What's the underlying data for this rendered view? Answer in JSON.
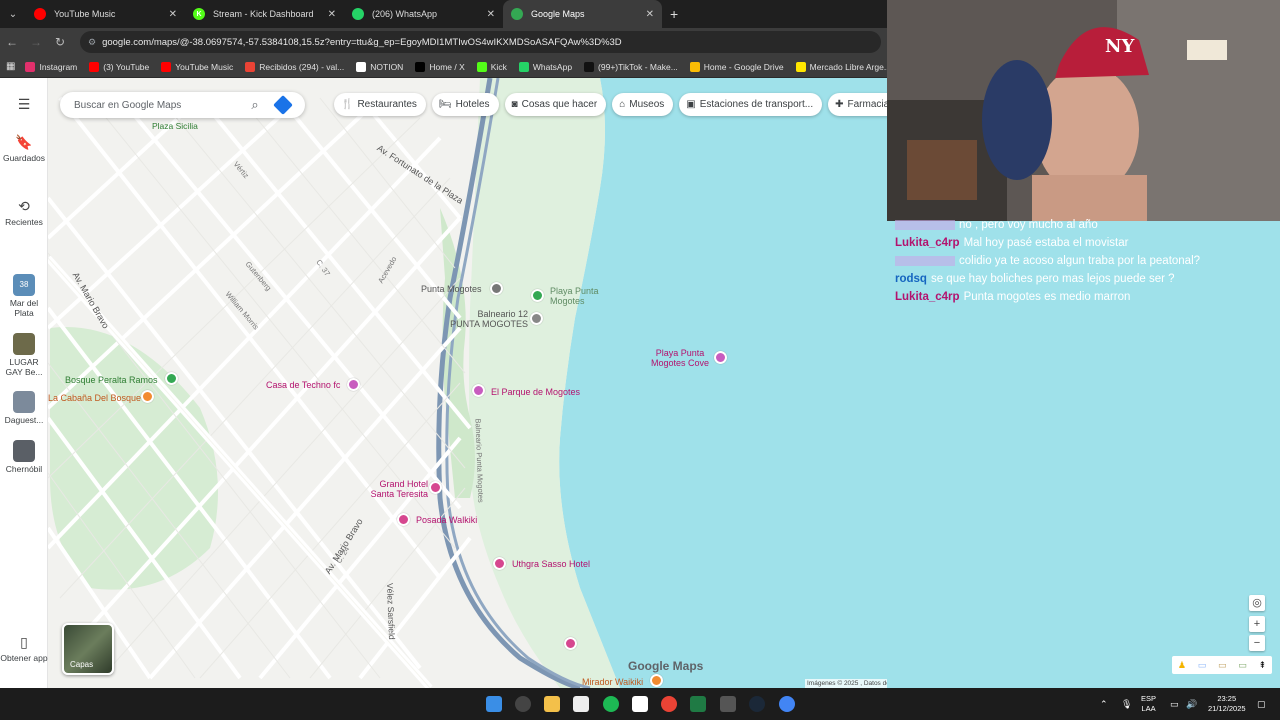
{
  "browser": {
    "tabs": [
      {
        "label": "YouTube Music",
        "color": "#ff0000",
        "glyph": ""
      },
      {
        "label": "Stream - Kick Dashboard",
        "color": "#53fc18",
        "glyph": "K"
      },
      {
        "label": "(206) WhatsApp",
        "color": "#25d366",
        "glyph": ""
      },
      {
        "label": "Google Maps",
        "color": "#34a853",
        "glyph": ""
      }
    ],
    "active_tab": 3,
    "url": "google.com/maps/@-38.0697574,-57.5384108,15.5z?entry=ttu&g_ep=EgoyMDI1MTIwOS4wIKXMDSoASAFQAw%3D%3D",
    "bookmarks": [
      {
        "label": "Instagram",
        "color": "#e1306c"
      },
      {
        "label": "(3) YouTube",
        "color": "#ff0000"
      },
      {
        "label": "YouTube Music",
        "color": "#ff0000"
      },
      {
        "label": "Recibidos (294) - val...",
        "color": "#ea4335"
      },
      {
        "label": "NOTION",
        "color": "#ffffff"
      },
      {
        "label": "Home / X",
        "color": "#000000"
      },
      {
        "label": "Kick",
        "color": "#53fc18"
      },
      {
        "label": "WhatsApp",
        "color": "#25d366"
      },
      {
        "label": "(99+)TikTok - Make...",
        "color": "#111111"
      },
      {
        "label": "Home - Google Drive",
        "color": "#fbbc04"
      },
      {
        "label": "Mercado Libre Arge...",
        "color": "#ffe600"
      }
    ]
  },
  "maps": {
    "search_placeholder": "Buscar en Google Maps",
    "rail": {
      "saved": "Guardados",
      "recent": "Recientes",
      "places": [
        {
          "label": "Mar del Plata",
          "badge": "38",
          "color": "#5b8db8"
        },
        {
          "label": "LUGAR GAY Be...",
          "color": "#6d6a4a"
        },
        {
          "label": "Daguest...",
          "color": "#7c8a9b"
        },
        {
          "label": "Chernóbil",
          "color": "#5a5f66"
        }
      ],
      "get_app": "Obtener app"
    },
    "chips": [
      {
        "label": "Restaurantes",
        "icon": "fork-knife-icon"
      },
      {
        "label": "Hoteles",
        "icon": "bed-icon"
      },
      {
        "label": "Cosas que hacer",
        "icon": "camera-icon"
      },
      {
        "label": "Museos",
        "icon": "museum-icon"
      },
      {
        "label": "Estaciones de transport...",
        "icon": "transit-icon"
      },
      {
        "label": "Farmacias",
        "icon": "pharmacy-icon"
      }
    ],
    "places": {
      "plaza_sicilia": "Plaza Sicilia",
      "punta_mogotes": "Punta Mogotes",
      "playa_punta_mogotes": "Playa Punta Mogotes",
      "balneario_12": "Balneario 12 PUNTA MOGOTES",
      "playa_cove": "Playa Punta Mogotes Cove",
      "parque": "El Parque de Mogotes",
      "bosque": "Bosque Peralta Ramos",
      "cabana": "La Cabaña Del Bosque",
      "techno": "Casa de Techno fc",
      "grand_hotel": "Grand Hotel Santa Teresita",
      "posada": "Posada Walkiki",
      "uthgra": "Uthgra Sasso Hotel",
      "mirador": "Mirador Waikiki"
    },
    "streets": {
      "fortunato": "Av. Fortunato de la Plaza",
      "mario_bravo": "Av. Mario Bravo",
      "mario_bravo2": "Av. Mario Bravo",
      "balneario": "Balneario Punta Mogotes",
      "velez": "Vélez Sarsfield",
      "gutenberg": "Gutenberg",
      "william": "William Morris",
      "acevedo": "Acevedo",
      "vertiz": "Vértiz",
      "c37": "C. 37",
      "c24": "C. 24"
    },
    "layers_label": "Capas",
    "logo": "Google Maps",
    "attribution": "Imágenes © 2025 , Datos del mapa © 2025    Argentina    Condiciones    Privacidad    Enviar comentarios sobre el producto    200 m"
  },
  "chat": {
    "messages": [
      {
        "user": "",
        "user_color": "#c8a8e8",
        "text": "no , pero voy mucho al año"
      },
      {
        "user": "Lukita_c4rp",
        "user_color": "#b3126e",
        "text": "Mal hoy pasé estaba el movistar"
      },
      {
        "user": "",
        "user_color": "#c8a8e8",
        "text": "colidio ya te acoso algun traba por la peatonal?"
      },
      {
        "user": "rodsq",
        "user_color": "#1565c0",
        "text": "se que hay boliches pero mas lejos puede ser ?"
      },
      {
        "user": "Lukita_c4rp",
        "user_color": "#b3126e",
        "text": "Punta mogotes es medio marron"
      }
    ]
  },
  "taskbar": {
    "lang": "ESP",
    "lang2": "LAA",
    "time": "23:25",
    "date": "21/12/2025"
  }
}
